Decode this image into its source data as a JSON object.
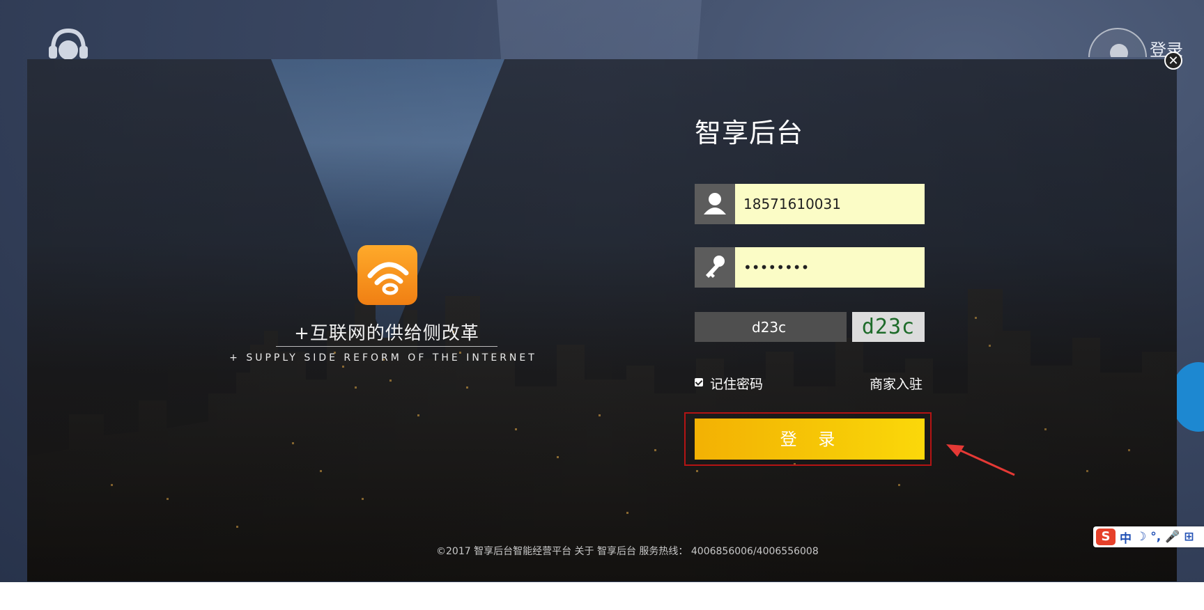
{
  "top": {
    "login_label": "登录"
  },
  "modal": {
    "close_symbol": "✕",
    "slogan_cn": "+互联网的供给侧改革",
    "slogan_en": "+ SUPPLY SIDE REFORM OF THE INTERNET"
  },
  "form": {
    "title": "智享后台",
    "username_value": "18571610031",
    "password_value": "••••••••",
    "captcha_value": "d23c",
    "captcha_image_text": "d23c",
    "remember_label": "记住密码",
    "merchant_link": "商家入驻",
    "login_button": "登 录"
  },
  "footer": {
    "text": "©2017 智享后台智能经营平台 关于 智享后台 服务热线： 4006856006/4006556008"
  },
  "ime": {
    "logo": "S",
    "mode": "中",
    "moon": "☽",
    "punct": "°,",
    "mic": "🎤",
    "keyboard": "⊞"
  },
  "colors": {
    "login_button": "#f6c806",
    "input_bg": "#fbfcc6",
    "highlight": "#b41414",
    "arrow": "#e53935",
    "logo_orange": "#f59a1c"
  }
}
